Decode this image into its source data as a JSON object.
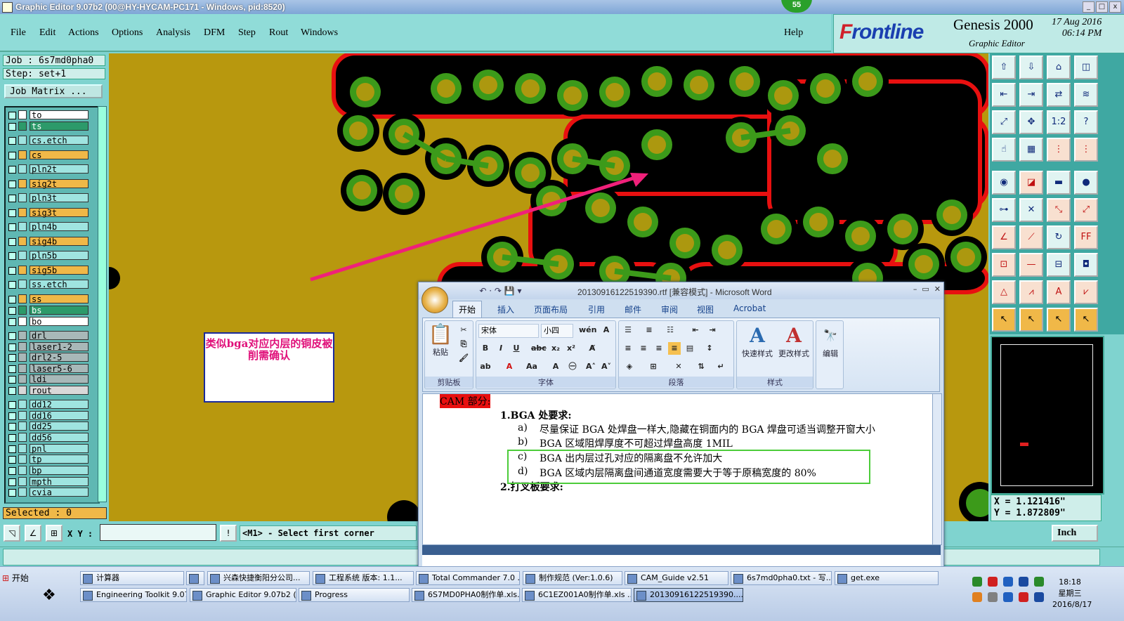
{
  "window": {
    "title": "Graphic Editor 9.07b2 (00@HY-HYCAM-PC171 - Windows, pid:8520)",
    "badge": "55",
    "controls": [
      "_",
      "□",
      "x"
    ]
  },
  "menu": [
    "File",
    "Edit",
    "Actions",
    "Options",
    "Analysis",
    "DFM",
    "Step",
    "Rout",
    "Windows"
  ],
  "help": "Help",
  "brand": {
    "logo_prefix": "F",
    "logo": "rontline",
    "product": "Genesis 2000",
    "subtitle": "Graphic Editor",
    "date": "17 Aug 2016",
    "time": "06:14 PM"
  },
  "job": {
    "job_line": "Job : 6s7md0pha0",
    "step_line": "Step: set+1",
    "matrix_button": "Job Matrix ...",
    "selected": "Selected : 0"
  },
  "layers": [
    {
      "name": "to",
      "color": "#ffffff"
    },
    {
      "name": "ts",
      "color": "#2c9a6a"
    },
    {
      "name": "cs.etch",
      "color": "#9fe4e0"
    },
    {
      "name": "cs",
      "color": "#f0b848"
    },
    {
      "name": "pln2t",
      "color": "#9fe4e0"
    },
    {
      "name": "sig2t",
      "color": "#f0b848"
    },
    {
      "name": "pln3t",
      "color": "#9fe4e0"
    },
    {
      "name": "sig3t",
      "color": "#f0b848"
    },
    {
      "name": "pln4b",
      "color": "#9fe4e0"
    },
    {
      "name": "sig4b",
      "color": "#f0b848"
    },
    {
      "name": "pln5b",
      "color": "#9fe4e0"
    },
    {
      "name": "sig5b",
      "color": "#f0b848"
    },
    {
      "name": "ss.etch",
      "color": "#9fe4e0"
    },
    {
      "name": "ss",
      "color": "#f0b848"
    },
    {
      "name": "bs",
      "color": "#2c9a6a"
    },
    {
      "name": "bo",
      "color": "#ffffff"
    },
    {
      "name": "drl",
      "color": "#a8b8b8"
    },
    {
      "name": "laser1-2",
      "color": "#a8b8b8"
    },
    {
      "name": "drl2-5",
      "color": "#a8b8b8"
    },
    {
      "name": "laser5-6",
      "color": "#a8b8b8"
    },
    {
      "name": "ldi",
      "color": "#a8b8b8"
    },
    {
      "name": "rout",
      "color": "#d8d8d8"
    },
    {
      "name": "dd12",
      "color": "#9fe4e0"
    },
    {
      "name": "dd16",
      "color": "#9fe4e0"
    },
    {
      "name": "dd25",
      "color": "#9fe4e0"
    },
    {
      "name": "dd56",
      "color": "#9fe4e0"
    },
    {
      "name": "pnl",
      "color": "#9fe4e0"
    },
    {
      "name": "tp",
      "color": "#9fe4e0"
    },
    {
      "name": "bp",
      "color": "#9fe4e0"
    },
    {
      "name": "mpth",
      "color": "#9fe4e0"
    },
    {
      "name": "cvia",
      "color": "#9fe4e0"
    }
  ],
  "annotation": "类似bga对应内层的铜皮被削需确认",
  "coords": {
    "x": "X = 1.121416\"",
    "y": "Y = 1.872809\""
  },
  "command": {
    "xy_label": "X Y :",
    "xy_value": "",
    "info_glyph": "!",
    "message": "<M1> - Select first corner",
    "units": "Inch"
  },
  "tool_icons": [
    "home-up",
    "home-down",
    "home",
    "panel",
    "left",
    "right",
    "swap",
    "edit",
    "fit",
    "zoom-all",
    "ratio-1-2",
    "help",
    "measure",
    "grid",
    "red-1",
    "red-2",
    "point",
    "cross-red",
    "ruler",
    "black-dot",
    "connect",
    "move-cross",
    "diag",
    "diag-2",
    "angle",
    "diag-3",
    "arc",
    "ff",
    "dot-red",
    "line-red",
    "counter",
    "blue-square",
    "tri-1",
    "tri-2",
    "tri-3",
    "tri-4",
    "cursor-1",
    "cursor-2",
    "cursor-3",
    "cursor-4"
  ],
  "word": {
    "title": "20130916122519390.rtf [兼容模式] - Microsoft Word",
    "tabs": [
      "开始",
      "插入",
      "页面布局",
      "引用",
      "邮件",
      "审阅",
      "视图",
      "Acrobat"
    ],
    "groups": [
      "剪贴板",
      "字体",
      "段落",
      "样式",
      "编辑"
    ],
    "paste": "粘贴",
    "font": "宋体",
    "size": "小四",
    "quick_style": "快速样式",
    "change_style": "更改样式",
    "edit": "编辑",
    "doc": {
      "heading": "CAM 部分:",
      "h1": "1.BGA 处要求:",
      "a_mark": "a)",
      "a": "尽量保证 BGA 处焊盘一样大,隐藏在铜面内的 BGA 焊盘可适当调整开窗大小",
      "b_mark": "b)",
      "b": "BGA 区域阻焊厚度不可超过焊盘高度 1MIL",
      "c_mark": "c)",
      "c": "BGA 出内层过孔对应的隔离盘不允许加大",
      "d_mark": "d)",
      "d": "BGA 区域内层隔离盘间通道宽度需要大于等于原稿宽度的 80%",
      "h2": "2.打叉板要求:"
    }
  },
  "taskbar": {
    "start": "开始",
    "row1": [
      "计算器",
      "",
      "兴森快捷衡阳分公司...",
      "工程系统  版本: 1.1...",
      "Total Commander 7.0 ...",
      "制作规范 (Ver:1.0.6)",
      "CAM_Guide v2.51",
      "6s7md0pha0.txt - 写...",
      "get.exe"
    ],
    "row2": [
      "Engineering Toolkit 9.07...",
      "Graphic Editor 9.07b2 (0...",
      "Progress",
      "6S7MD0PHA0制作单.xls...",
      "6C1EZ001A0制作单.xls ...",
      "20130916122519390...."
    ],
    "time": "18:18",
    "weekday": "星期三",
    "date": "2016/8/17"
  },
  "colors": {
    "board": "#b8980e",
    "pad": "#3c9a1a",
    "clearance": "#000000",
    "outline": "#e81010",
    "arrow": "#f0207a"
  }
}
